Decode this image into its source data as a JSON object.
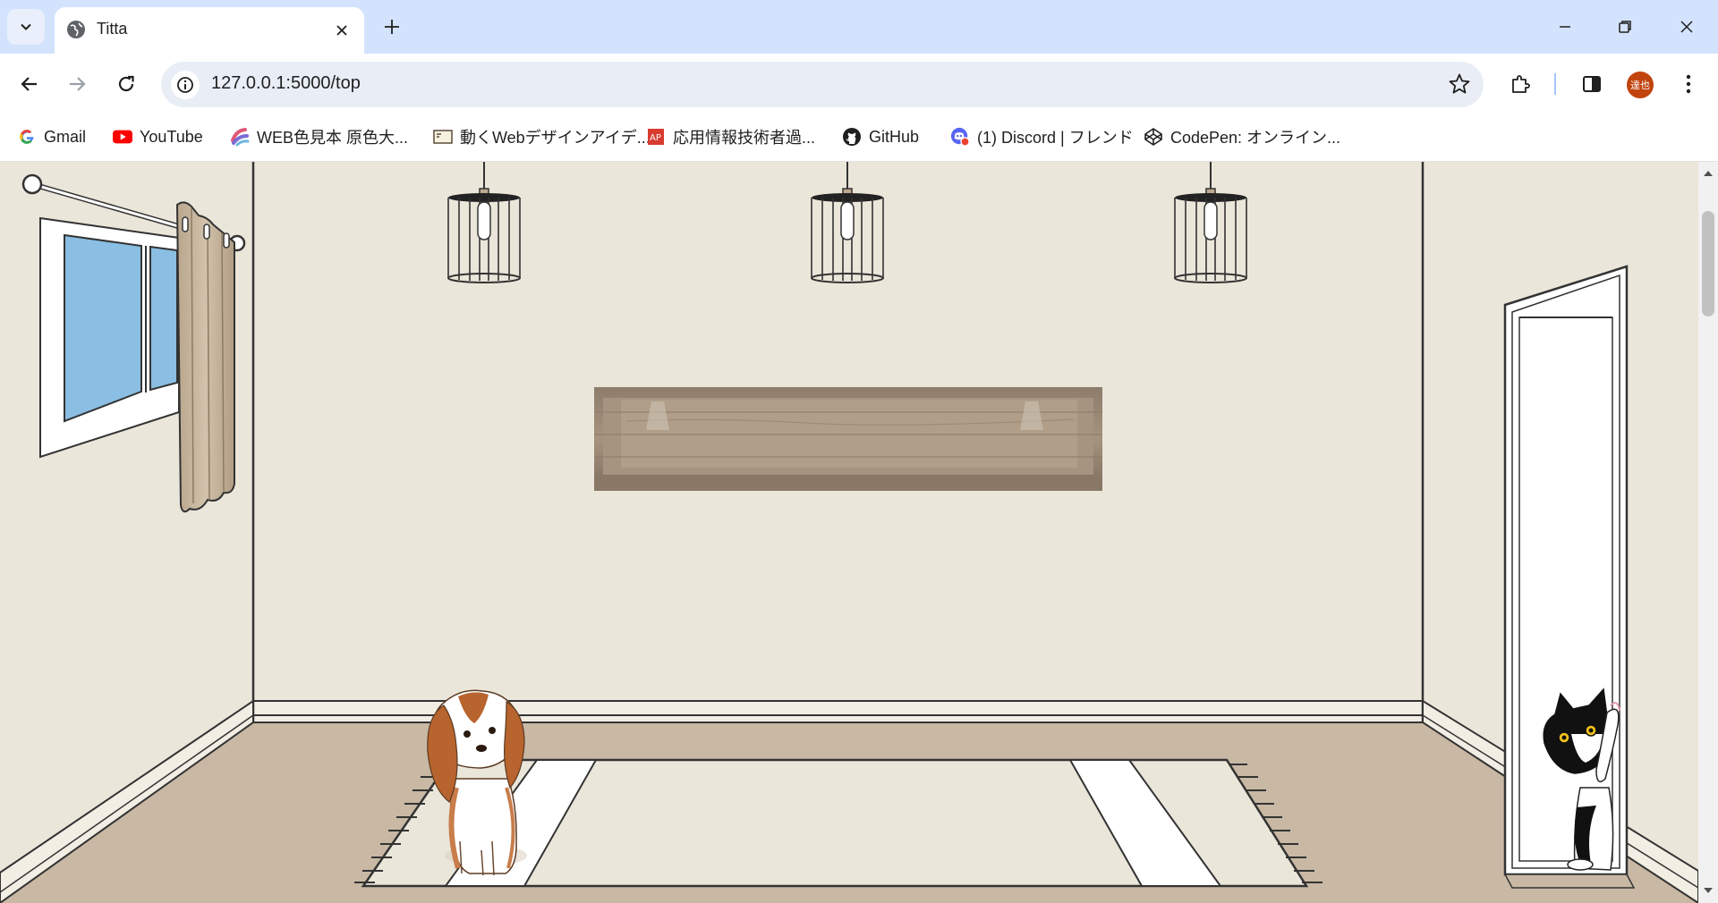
{
  "tab": {
    "title": "Titta"
  },
  "address_bar": {
    "url": "127.0.0.1:5000/top"
  },
  "profile": {
    "initials": "達也",
    "color": "#c1440e"
  },
  "bookmarks": [
    {
      "label": "Gmail",
      "icon": "google-icon"
    },
    {
      "label": "YouTube",
      "icon": "youtube-icon"
    },
    {
      "label": "WEB色見本 原色大...",
      "icon": "color-palette-icon"
    },
    {
      "label": "動くWebデザインアイデ...",
      "icon": "web-design-icon"
    },
    {
      "label": "応用情報技術者過...",
      "icon": "exam-icon"
    },
    {
      "label": "GitHub",
      "icon": "github-icon"
    },
    {
      "label": "(1) Discord | フレンド",
      "icon": "discord-icon"
    },
    {
      "label": "CodePen: オンライン...",
      "icon": "codepen-icon"
    }
  ],
  "room": {
    "wall_color": "#ebe6da",
    "floor_color": "#c8b8a4",
    "window_glass_color": "#8abee2",
    "curtain_color": "#c4b29a",
    "items": [
      "window",
      "curtain",
      "pendant-lamp",
      "pendant-lamp",
      "pendant-lamp",
      "wooden-wall-shelf",
      "rug",
      "dog",
      "door",
      "cat"
    ]
  }
}
